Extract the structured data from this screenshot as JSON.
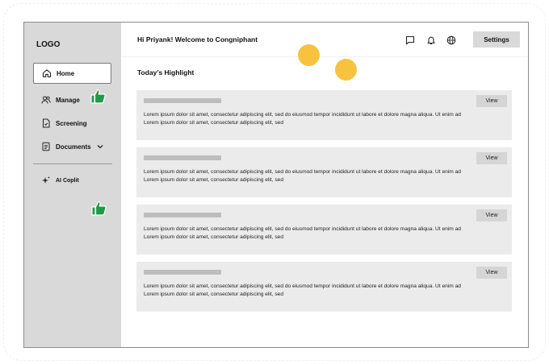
{
  "sidebar": {
    "logo": "LOGO",
    "items": [
      {
        "label": "Home",
        "icon": "home-icon"
      },
      {
        "label": "Manage",
        "icon": "users-icon"
      },
      {
        "label": "Screening",
        "icon": "document-icon"
      },
      {
        "label": "Documents",
        "icon": "documents-icon"
      }
    ],
    "ai_label": "AI Coplit"
  },
  "header": {
    "greeting": "Hi Priyank! Welcome to Congniphant",
    "settings_label": "Settings",
    "icons": [
      "chat-icon",
      "bell-icon",
      "globe-icon"
    ]
  },
  "main": {
    "section_title": "Today’s Highlight",
    "cards": [
      {
        "view_label": "View",
        "line1": "Lorem ipsum dolor sit amet, consectetur adipiscing elit, sed do eiusmod tempor incididunt ut labore et dolore magna aliqua. Ut enim ad",
        "line2": "Lorem ipsum dolor sit amet, consectetur adipiscing elit, sed"
      },
      {
        "view_label": "View",
        "line1": "Lorem ipsum dolor sit amet, consectetur adipiscing elit, sed do eiusmod tempor incididunt ut labore et dolore magna aliqua. Ut enim ad",
        "line2": "Lorem ipsum dolor sit amet, consectetur adipiscing elit, sed"
      },
      {
        "view_label": "View",
        "line1": "Lorem ipsum dolor sit amet, consectetur adipiscing elit, sed do eiusmod tempor incididunt ut labore et dolore magna aliqua. Ut enim ad",
        "line2": "Lorem ipsum dolor sit amet, consectetur adipiscing elit, sed"
      },
      {
        "view_label": "View",
        "line1": "Lorem ipsum dolor sit amet, consectetur adipiscing elit, sed do eiusmod tempor incididunt ut labore et dolore magna aliqua. Ut enim ad",
        "line2": "Lorem ipsum dolor sit amet, consectetur adipiscing elit, sed"
      }
    ]
  },
  "colors": {
    "sidebar_bg": "#d9d9d9",
    "card_bg": "#ebebeb",
    "accent_dot": "#f7c33f",
    "thumb_green": "#1f9a48"
  }
}
